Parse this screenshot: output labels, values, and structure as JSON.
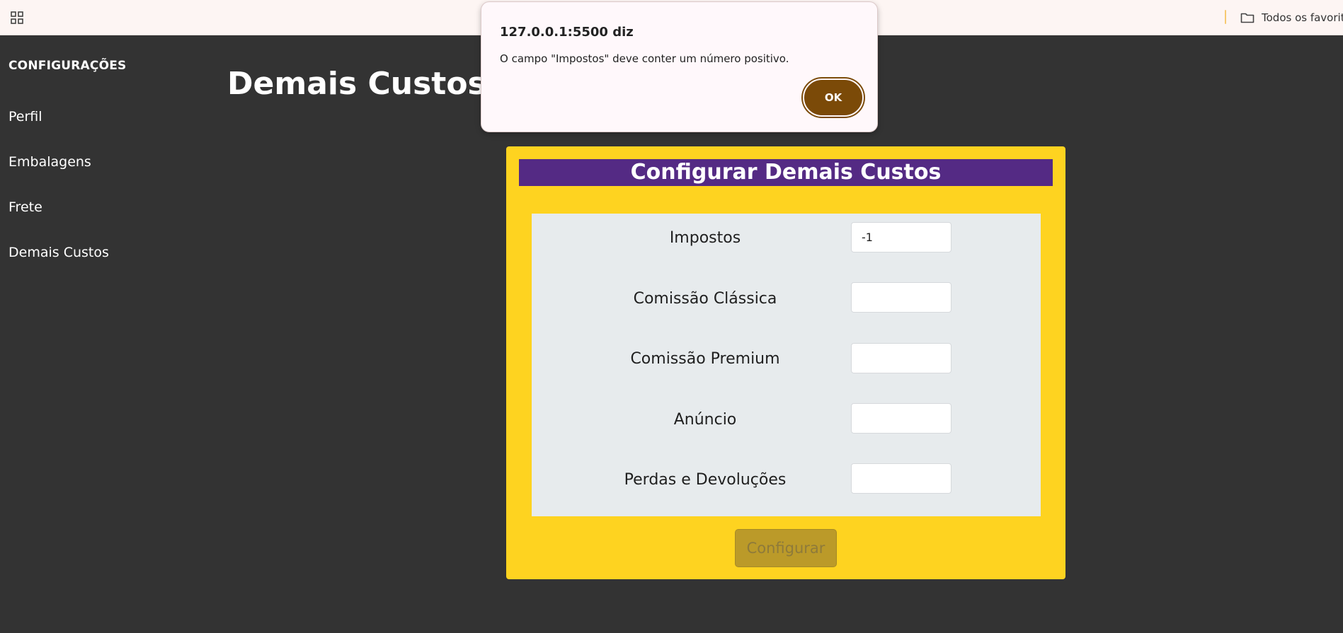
{
  "browser": {
    "bookmarks_label": "Todos os favoritos"
  },
  "sidebar": {
    "title": "CONFIGURAÇÕES",
    "items": [
      {
        "label": "Perfil"
      },
      {
        "label": "Embalagens"
      },
      {
        "label": "Frete"
      },
      {
        "label": "Demais Custos"
      }
    ]
  },
  "page": {
    "title": "Demais Custos"
  },
  "form": {
    "header": "Configurar Demais Custos",
    "fields": [
      {
        "label": "Impostos",
        "value": "-1"
      },
      {
        "label": "Comissão Clássica",
        "value": ""
      },
      {
        "label": "Comissão Premium",
        "value": ""
      },
      {
        "label": "Anúncio",
        "value": ""
      },
      {
        "label": "Perdas e Devoluções",
        "value": ""
      }
    ],
    "submit_label": "Configurar"
  },
  "dialog": {
    "title": "127.0.0.1:5500 diz",
    "message": "O campo \"Impostos\" deve conter um número positivo.",
    "ok_label": "OK"
  },
  "colors": {
    "background": "#333333",
    "card": "#fed320",
    "header": "#542a84",
    "panel": "#e7ebed",
    "ok_button": "#7b4a08",
    "submit_button": "#bb9a29"
  }
}
